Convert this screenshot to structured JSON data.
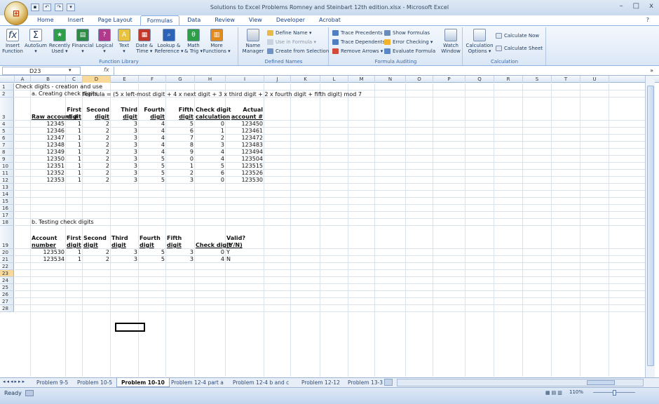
{
  "window": {
    "title": "Solutions to Excel Problems Romney and Steinbart 12th edition.xlsx - Microsoft Excel",
    "minimize": "–",
    "maximize": "□",
    "close": "x"
  },
  "ribbon_tabs": [
    "Home",
    "Insert",
    "Page Layout",
    "Formulas",
    "Data",
    "Review",
    "View",
    "Developer",
    "Acrobat"
  ],
  "active_tab": "Formulas",
  "ribbon": {
    "function_library": {
      "label": "Function Library",
      "buttons": [
        {
          "name": "insert-function",
          "label": "Insert\nFunction",
          "icon": "fx-icon"
        },
        {
          "name": "autosum",
          "label": "AutoSum\n▾",
          "icon": "sigma-icon"
        },
        {
          "name": "recently-used",
          "label": "Recently\nUsed ▾",
          "icon": "star-book-icon"
        },
        {
          "name": "financial",
          "label": "Financial\n▾",
          "icon": "book-icon"
        },
        {
          "name": "logical",
          "label": "Logical\n▾",
          "icon": "question-book-icon"
        },
        {
          "name": "text",
          "label": "Text\n▾",
          "icon": "text-book-icon"
        },
        {
          "name": "date-time",
          "label": "Date &\nTime ▾",
          "icon": "calendar-book-icon"
        },
        {
          "name": "lookup-reference",
          "label": "Lookup &\nReference ▾",
          "icon": "lookup-book-icon"
        },
        {
          "name": "math-trig",
          "label": "Math\n& Trig ▾",
          "icon": "theta-book-icon"
        },
        {
          "name": "more-functions",
          "label": "More\nFunctions ▾",
          "icon": "books-icon"
        }
      ]
    },
    "defined_names": {
      "label": "Defined Names",
      "name_manager": "Name\nManager",
      "define_name": "Define Name ▾",
      "use_in_formula": "Use in Formula ▾",
      "create_from_selection": "Create from Selection"
    },
    "formula_auditing": {
      "label": "Formula Auditing",
      "trace_precedents": "Trace Precedents",
      "trace_dependents": "Trace Dependents",
      "remove_arrows": "Remove Arrows ▾",
      "show_formulas": "Show Formulas",
      "error_checking": "Error Checking ▾",
      "evaluate_formula": "Evaluate Formula",
      "watch_window": "Watch\nWindow"
    },
    "calculation": {
      "label": "Calculation",
      "calculation_options": "Calculation\nOptions ▾",
      "calculate_now": "Calculate Now",
      "calculate_sheet": "Calculate Sheet"
    }
  },
  "formula_bar": {
    "name_box": "D23",
    "fx": "fx",
    "value": ""
  },
  "columns": [
    "A",
    "B",
    "C",
    "D",
    "E",
    "F",
    "G",
    "H",
    "I",
    "J",
    "K",
    "L",
    "M",
    "N",
    "O",
    "P",
    "Q",
    "R",
    "S",
    "T",
    "U"
  ],
  "selected_column": "D",
  "selected_row": "23",
  "rows": [
    "1",
    "2",
    "3",
    "4",
    "5",
    "6",
    "7",
    "8",
    "9",
    "10",
    "11",
    "12",
    "13",
    "14",
    "15",
    "16",
    "17",
    "18",
    "19",
    "20",
    "21",
    "22",
    "23",
    "24",
    "25",
    "26",
    "27",
    "28"
  ],
  "sheet": {
    "title": "Check digits - creation and use",
    "section_a": "a. Creating check digits",
    "formula_text": "Formula = (5 x left-most digit + 4 x next digit + 3 x third digit + 2 x fourth digit + fifth digit) mod 7",
    "headers_a": {
      "raw": "Raw account #",
      "first_top": "First",
      "first_bot": "digit",
      "second_top": "Second",
      "second_bot": "digit",
      "third_top": "Third",
      "third_bot": "digit",
      "fourth_top": "Fourth",
      "fourth_bot": "digit",
      "fifth_top": "Fifth",
      "fifth_bot": "digit",
      "check_top": "Check digit",
      "check_bot": "calculation",
      "actual_top": "Actual",
      "actual_bot": "account #"
    },
    "table_a": [
      [
        "12345",
        "1",
        "2",
        "3",
        "4",
        "5",
        "0",
        "123450"
      ],
      [
        "12346",
        "1",
        "2",
        "3",
        "4",
        "6",
        "1",
        "123461"
      ],
      [
        "12347",
        "1",
        "2",
        "3",
        "4",
        "7",
        "2",
        "123472"
      ],
      [
        "12348",
        "1",
        "2",
        "3",
        "4",
        "8",
        "3",
        "123483"
      ],
      [
        "12349",
        "1",
        "2",
        "3",
        "4",
        "9",
        "4",
        "123494"
      ],
      [
        "12350",
        "1",
        "2",
        "3",
        "5",
        "0",
        "4",
        "123504"
      ],
      [
        "12351",
        "1",
        "2",
        "3",
        "5",
        "1",
        "5",
        "123515"
      ],
      [
        "12352",
        "1",
        "2",
        "3",
        "5",
        "2",
        "6",
        "123526"
      ],
      [
        "12353",
        "1",
        "2",
        "3",
        "5",
        "3",
        "0",
        "123530"
      ]
    ],
    "section_b": "b. Testing check digits",
    "headers_b": {
      "account_top": "Account",
      "account_bot": "number",
      "first_top": "First",
      "first_bot": "digit",
      "second_top": "Second",
      "second_bot": "digit",
      "third_top": "Third",
      "third_bot": "digit",
      "fourth_top": "Fourth",
      "fourth_bot": "digit",
      "fifth_top": "Fifth",
      "fifth_bot": "digit",
      "check": "Check digit",
      "valid_top": "Valid?",
      "valid_bot": "(Y/N)"
    },
    "table_b": [
      [
        "123530",
        "1",
        "2",
        "3",
        "5",
        "3",
        "0",
        "Y"
      ],
      [
        "123534",
        "1",
        "2",
        "3",
        "5",
        "3",
        "4",
        "N"
      ]
    ]
  },
  "sheet_tabs": [
    "Problem 9-5",
    "Problem 10-5",
    "Problem 10-10",
    "Problem 12-4 part a",
    "Problem 12-4 b and c",
    "Problem 12-12",
    "Problem 13-3"
  ],
  "active_sheet": "Problem 10-10",
  "status": {
    "ready": "Ready",
    "zoom": "110%"
  }
}
